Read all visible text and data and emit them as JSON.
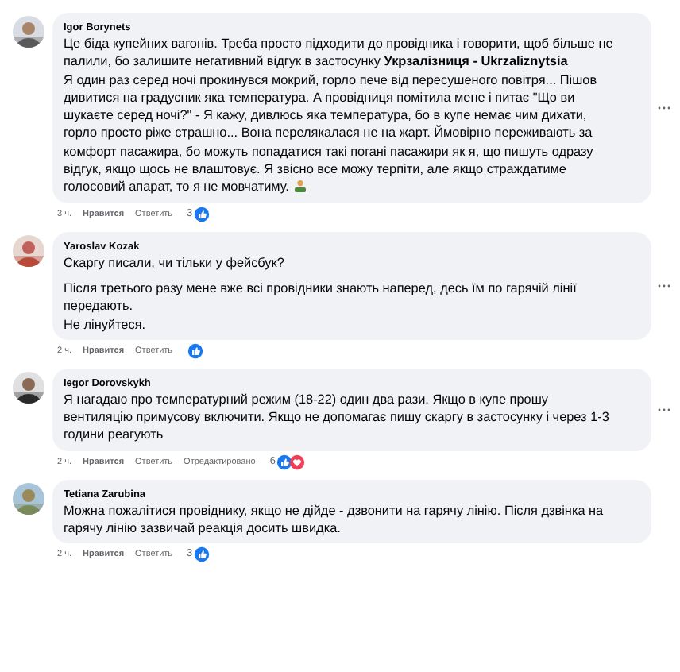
{
  "comments": [
    {
      "author": "Igor Borynets",
      "paragraphs": [
        [
          "Це біда купейних вагонів. Треба просто підходити до провідника і говорити, щоб більше не палили, бо залишите негативний відгук в застосунку **Укрзалізниця - Ukrzaliznytsia**",
          "Я один раз серед ночі прокинувся мокрий, горло пече від пересушеного повітря... Пішов дивитися на градусник яка температура. А провідниця помітила мене і питає \"Що ви шукаєте серед ночі?\" - Я кажу, дивлюсь яка температура, бо в купе немає чим дихати, горло просто ріже страшно... Вона перелякалася не на жарт. Ймовірно переживають за комфорт пасажира, бо можуть попадатися такі погані пасажири як я, що пишуть одразу відгук, якщо щось не влаштовує. Я звісно все можу терпіти, але якщо страждатиме голосовий апарат, то я не мовчатиму."
        ]
      ],
      "emoji": true,
      "time": "3 ч.",
      "like": "Нравится",
      "reply": "Ответить",
      "count": "3",
      "reactions": [
        {
          "kind": "like"
        }
      ],
      "menu": true
    },
    {
      "author": "Yaroslav Kozak",
      "paragraphs": [
        [
          "Скаргу писали, чи тільки у фейсбук?"
        ],
        [
          "Після третього разу мене вже всі провідники знають наперед, десь їм по гарячій лінії передають.",
          "Не лінуйтеся."
        ]
      ],
      "emoji": false,
      "time": "2 ч.",
      "like": "Нравится",
      "reply": "Ответить",
      "reactions": [
        {
          "kind": "like"
        }
      ],
      "menu": true
    },
    {
      "author": "Iegor Dorovskykh",
      "paragraphs": [
        [
          "Я нагадаю про температурний режим (18-22) один два рази. Якщо в купе прошу вентиляцію примусову включити. Якщо не допомагає пишу скаргу в застосунку і через 1-3 години реагують"
        ]
      ],
      "emoji": false,
      "time": "2 ч.",
      "like": "Нравится",
      "reply": "Ответить",
      "edited": "Отредактировано",
      "count": "6",
      "reactions": [
        {
          "kind": "like"
        },
        {
          "kind": "love"
        }
      ],
      "menu": true
    },
    {
      "author": "Tetiana Zarubina",
      "paragraphs": [
        [
          "Можна пожалітися провіднику, якщо не дійде - дзвонити на гарячу лінію. Після дзвінка на гарячу лінію зазвичай реакція досить швидка."
        ]
      ],
      "emoji": false,
      "time": "2 ч.",
      "like": "Нравится",
      "reply": "Ответить",
      "count": "3",
      "reactions": [
        {
          "kind": "like"
        }
      ],
      "menu": false
    }
  ]
}
